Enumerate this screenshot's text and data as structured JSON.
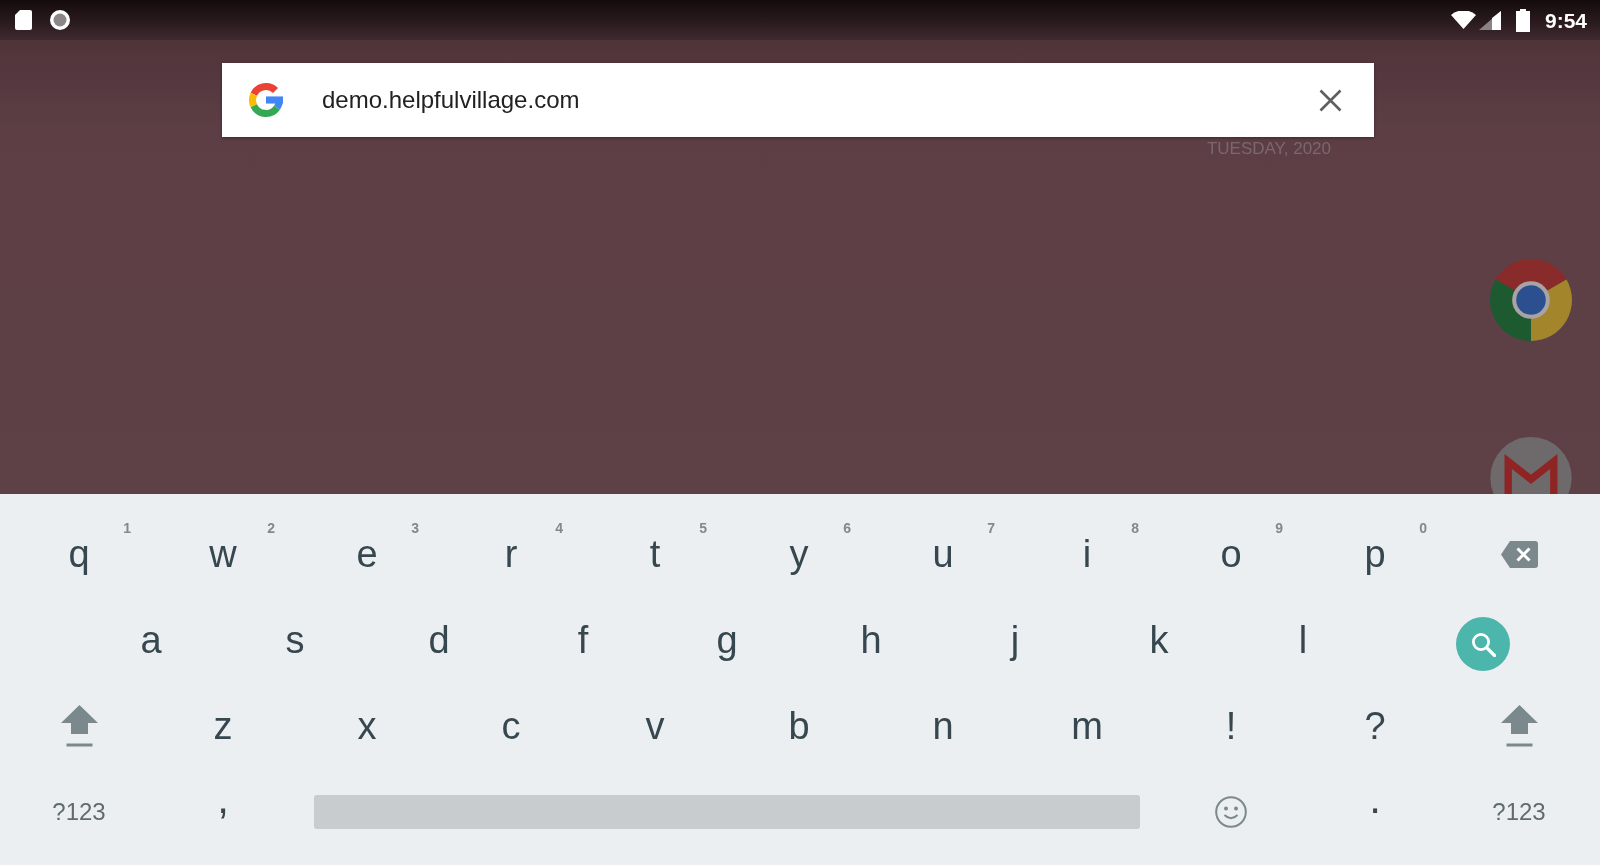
{
  "status_bar": {
    "time": "9:54"
  },
  "search_bar": {
    "value": "demo.helpfulvillage.com"
  },
  "clock_widget": {
    "date": "TUESDAY, 2020"
  },
  "keyboard": {
    "rows": [
      {
        "keys": [
          {
            "kind": "letter",
            "label": "q",
            "hint": "1"
          },
          {
            "kind": "letter",
            "label": "w",
            "hint": "2"
          },
          {
            "kind": "letter",
            "label": "e",
            "hint": "3"
          },
          {
            "kind": "letter",
            "label": "r",
            "hint": "4"
          },
          {
            "kind": "letter",
            "label": "t",
            "hint": "5"
          },
          {
            "kind": "letter",
            "label": "y",
            "hint": "6"
          },
          {
            "kind": "letter",
            "label": "u",
            "hint": "7"
          },
          {
            "kind": "letter",
            "label": "i",
            "hint": "8"
          },
          {
            "kind": "letter",
            "label": "o",
            "hint": "9"
          },
          {
            "kind": "letter",
            "label": "p",
            "hint": "0"
          },
          {
            "kind": "backspace"
          }
        ]
      },
      {
        "keys": [
          {
            "kind": "letter",
            "label": "a"
          },
          {
            "kind": "letter",
            "label": "s"
          },
          {
            "kind": "letter",
            "label": "d"
          },
          {
            "kind": "letter",
            "label": "f"
          },
          {
            "kind": "letter",
            "label": "g"
          },
          {
            "kind": "letter",
            "label": "h"
          },
          {
            "kind": "letter",
            "label": "j"
          },
          {
            "kind": "letter",
            "label": "k"
          },
          {
            "kind": "letter",
            "label": "l"
          },
          {
            "kind": "search"
          }
        ]
      },
      {
        "keys": [
          {
            "kind": "shift"
          },
          {
            "kind": "letter",
            "label": "z"
          },
          {
            "kind": "letter",
            "label": "x"
          },
          {
            "kind": "letter",
            "label": "c"
          },
          {
            "kind": "letter",
            "label": "v"
          },
          {
            "kind": "letter",
            "label": "b"
          },
          {
            "kind": "letter",
            "label": "n"
          },
          {
            "kind": "letter",
            "label": "m"
          },
          {
            "kind": "letter",
            "label": "!"
          },
          {
            "kind": "letter",
            "label": "?"
          },
          {
            "kind": "shift"
          }
        ]
      },
      {
        "keys": [
          {
            "kind": "symbols",
            "label": "?123"
          },
          {
            "kind": "punctuation",
            "label": ","
          },
          {
            "kind": "space"
          },
          {
            "kind": "emoji"
          },
          {
            "kind": "punctuation",
            "label": "."
          },
          {
            "kind": "symbols",
            "label": "?123"
          }
        ]
      }
    ]
  }
}
